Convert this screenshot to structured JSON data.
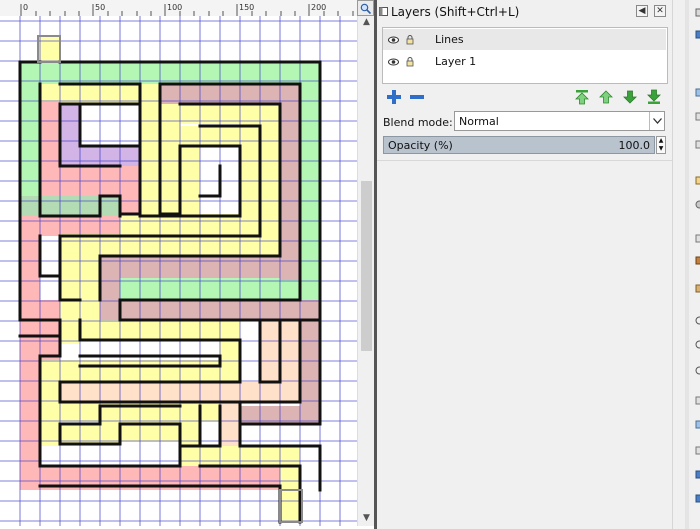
{
  "ruler": {
    "labels": [
      "0",
      "50",
      "100",
      "150",
      "200"
    ]
  },
  "layers_panel": {
    "title": "Layers (Shift+Ctrl+L)",
    "layers": [
      {
        "name": "Lines",
        "selected": true
      },
      {
        "name": "Layer 1",
        "selected": false
      }
    ],
    "blend_mode_label": "Blend mode:",
    "blend_mode_value": "Normal",
    "opacity_label": "Opacity (%)",
    "opacity_value": "100.0"
  },
  "colors": {
    "grid": "#3a39c9",
    "wall": "#111111",
    "yellow": "#ffffa8",
    "green": "#b4f7b4",
    "pink": "#ffb8b8",
    "brown": "#dcb4b4",
    "purple": "#d2b4e6",
    "peach": "#ffe0c8",
    "dark_green": "#b4dcb4"
  },
  "icons": {
    "zoom": "magnifier-icon",
    "dock": "dock-icon",
    "visibility": "eye-icon",
    "lock": "lock-icon",
    "add": "plus-icon",
    "remove": "minus-icon"
  }
}
